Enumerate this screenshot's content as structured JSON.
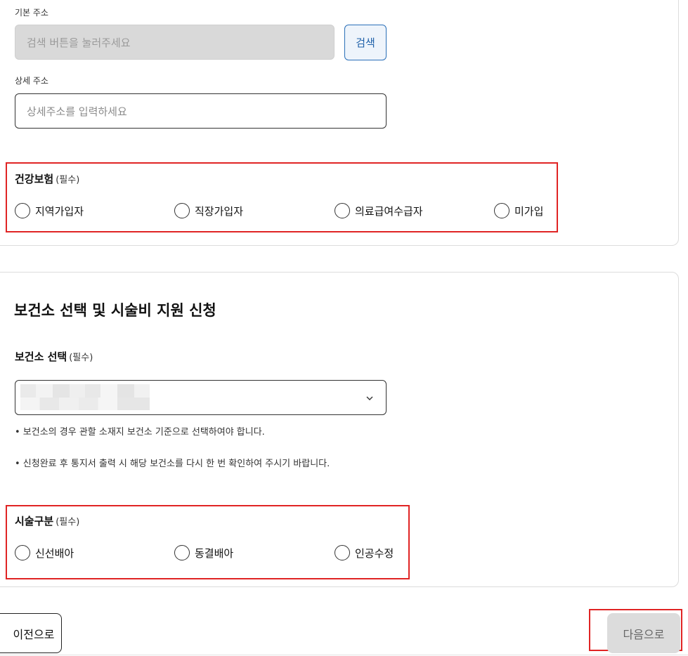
{
  "address": {
    "basic_label": "기본 주소",
    "basic_placeholder": "검색 버튼을 눌러주세요",
    "search_button": "검색",
    "detail_label": "상세 주소",
    "detail_placeholder": "상세주소를 입력하세요"
  },
  "insurance": {
    "label": "건강보험",
    "required": "(필수)",
    "options": [
      "지역가입자",
      "직장가입자",
      "의료급여수급자",
      "미가입"
    ]
  },
  "health_center": {
    "title": "보건소 선택 및 시술비 지원 신청",
    "select_label": "보건소 선택",
    "required": "(필수)",
    "notes": [
      "• 보건소의 경우 관할 소재지 보건소 기준으로 선택하여야 합니다.",
      "• 신청완료 후 통지서 출력 시 해당 보건소를 다시 한 번 확인하여 주시기 바랍니다."
    ]
  },
  "procedure": {
    "label": "시술구분",
    "required": "(필수)",
    "options": [
      "신선배아",
      "동결배아",
      "인공수정"
    ]
  },
  "nav": {
    "prev": "이전으로",
    "next": "다음으로"
  },
  "colors": {
    "highlight": "#e02424",
    "accent": "#1d5fa8"
  }
}
